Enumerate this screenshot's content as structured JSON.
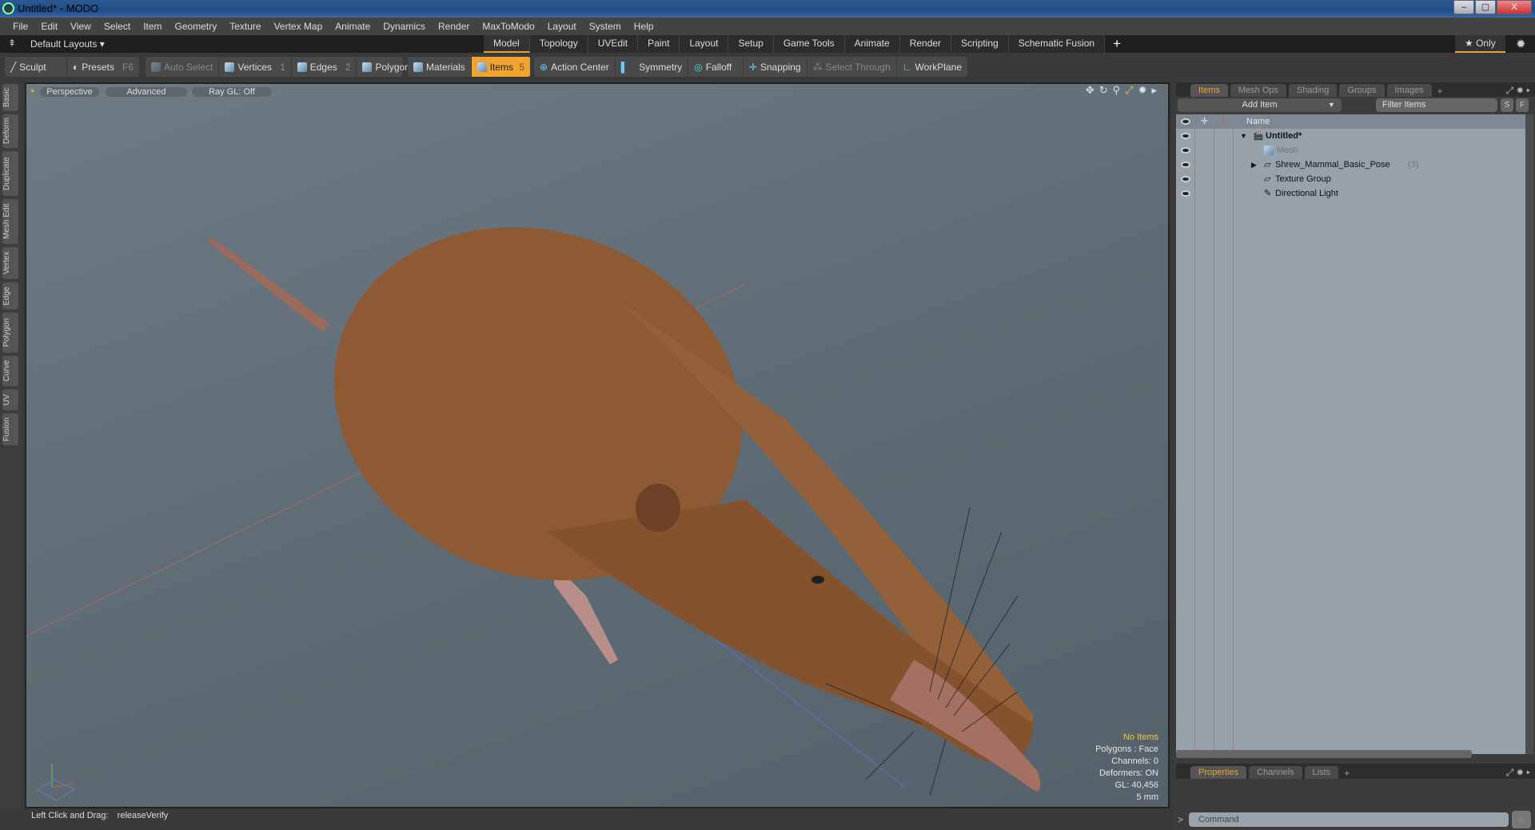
{
  "window": {
    "title": "Untitled* - MODO",
    "min": "–",
    "max": "▢",
    "close": "X"
  },
  "menu": [
    "File",
    "Edit",
    "View",
    "Select",
    "Item",
    "Geometry",
    "Texture",
    "Vertex Map",
    "Animate",
    "Dynamics",
    "Render",
    "MaxToModo",
    "Layout",
    "System",
    "Help"
  ],
  "layoutbar": {
    "layouts": "Default Layouts ▾",
    "tabs": [
      "Model",
      "Topology",
      "UVEdit",
      "Paint",
      "Layout",
      "Setup",
      "Game Tools",
      "Animate",
      "Render",
      "Scripting",
      "Schematic Fusion"
    ],
    "add": "+",
    "only": "★ Only"
  },
  "toolbar": {
    "sculpt": "Sculpt",
    "presets": "Presets",
    "presets_key": "F6",
    "auto_select": "Auto Select",
    "vertices": "Vertices",
    "vertices_key": "1",
    "edges": "Edges",
    "edges_key": "2",
    "polygons": "Polygons",
    "materials": "Materials",
    "items": "Items",
    "items_key": "5",
    "action_center": "Action Center",
    "symmetry": "Symmetry",
    "falloff": "Falloff",
    "snapping": "Snapping",
    "select_through": "Select Through",
    "workplane": "WorkPlane"
  },
  "lefttabs": [
    "Basic",
    "Deform",
    "Duplicate",
    "Mesh Edit",
    "Vertex",
    "Edge",
    "Polygon",
    "Curve",
    "UV",
    "Fusion"
  ],
  "viewport": {
    "perspective": "Perspective",
    "advanced": "Advanced",
    "raygl": "Ray GL: Off",
    "hud": {
      "selection": "No Items",
      "polygons": "Polygons : Face",
      "channels": "Channels: 0",
      "deformers": "Deformers: ON",
      "gl": "GL: 40,456",
      "scale": "5 mm"
    }
  },
  "status": {
    "hint": "Left Click and Drag:",
    "action": "releaseVerify"
  },
  "itemspanel": {
    "tabs": [
      "Items",
      "Mesh Ops",
      "Shading",
      "Groups",
      "Images"
    ],
    "add": "+",
    "add_item": "Add Item",
    "filter_placeholder": "Filter Items",
    "s": "S",
    "f": "F",
    "name_header": "Name",
    "tree": [
      {
        "name": "Untitled*",
        "expanded": "▼"
      },
      {
        "name": "Mesh"
      },
      {
        "name": "Shrew_Mammal_Basic_Pose",
        "count": "(3)",
        "expanded": "▶"
      },
      {
        "name": "Texture Group"
      },
      {
        "name": "Directional Light"
      }
    ]
  },
  "propspanel": {
    "tabs": [
      "Properties",
      "Channels",
      "Lists"
    ],
    "add": "+",
    "prompt": ">",
    "command_placeholder": "Command"
  },
  "colors": {
    "accent": "#f0a32d",
    "hud_highlight": "#f5c542"
  }
}
